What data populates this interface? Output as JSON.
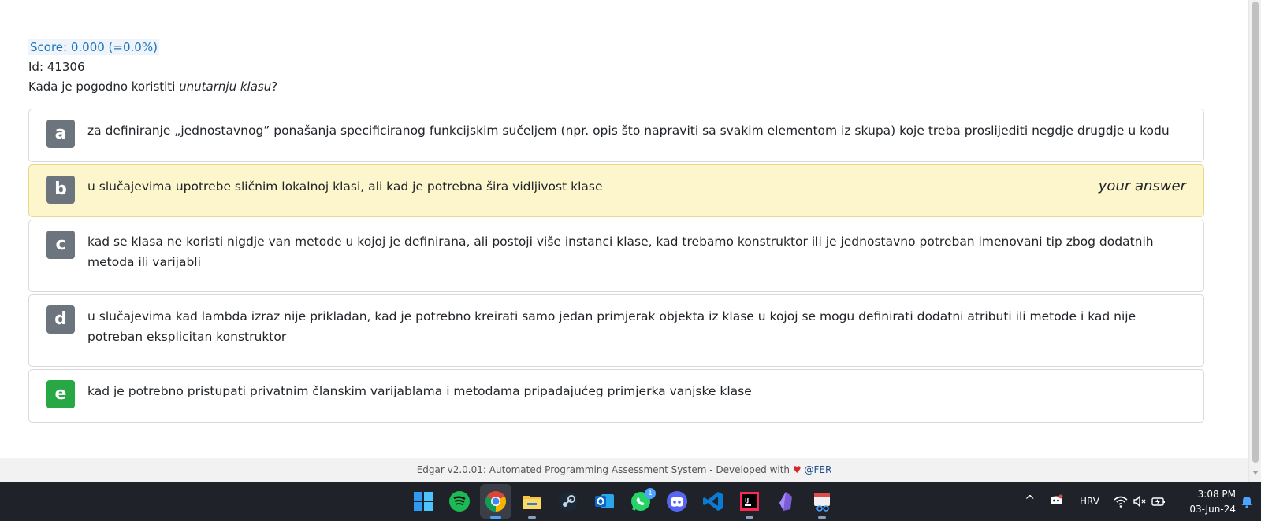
{
  "quiz": {
    "score": "Score: 0.000 (=0.0%)",
    "id": "Id: 41306",
    "question_prefix": "Kada je pogodno koristiti ",
    "question_emph": "unutarnju klasu",
    "question_suffix": "?"
  },
  "answers": [
    {
      "letter": "a",
      "text": "za definiranje „jednostavnog” ponašanja specificiranog funkcijskim sučeljem (npr. opis što napraviti sa svakim elementom iz skupa) koje treba proslijediti negdje drugdje u kodu"
    },
    {
      "letter": "b",
      "text": "u slučajevima upotrebe sličnim lokalnoj klasi, ali kad je potrebna šira vidljivost klase",
      "tag": "your answer"
    },
    {
      "letter": "c",
      "text": "kad se klasa ne koristi nigdje van metode u kojoj je definirana, ali postoji više instanci klase, kad trebamo konstruktor ili je jednostavno potreban imenovani tip zbog dodatnih metoda ili varijabli"
    },
    {
      "letter": "d",
      "text": "u slučajevima kad lambda izraz nije prikladan, kad je potrebno kreirati samo jedan primjerak objekta iz klase u kojoj se mogu definirati dodatni atributi ili metode i kad nije potreban eksplicitan konstruktor"
    },
    {
      "letter": "e",
      "text": "kad je potrebno pristupati privatnim članskim varijablama i metodama pripadajućeg primjerka vanjske klase"
    }
  ],
  "footer": {
    "text": "Edgar v2.0.01: Automated Programming Assessment System - Developed with",
    "heart": "♥",
    "org": "@FER"
  },
  "taskbar": {
    "apps": [
      "windows-start",
      "spotify",
      "chrome",
      "file-explorer",
      "steam",
      "outlook",
      "whatsapp",
      "discord",
      "vscode",
      "intellij",
      "obsidian",
      "snipping-tool"
    ],
    "whatsapp_badge": "1",
    "language": "HRV",
    "time": "3:08 PM",
    "date": "03-Jun-24"
  },
  "colors": {
    "score": "#1e73be",
    "selected_answer_bg": "#fdf6cc",
    "correct_letter": "#28a745",
    "default_letter": "#6c757d",
    "taskbar_bg": "#1f2329"
  }
}
